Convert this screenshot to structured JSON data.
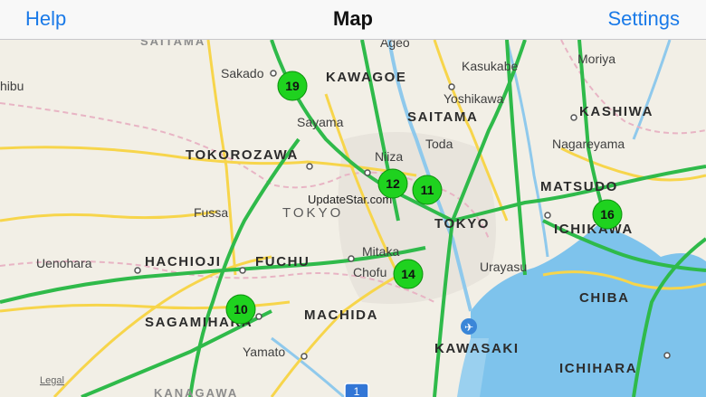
{
  "navbar": {
    "left": "Help",
    "title": "Map",
    "right": "Settings"
  },
  "map": {
    "places": {
      "saitama_pref": "SAITAMA",
      "kanagawa_pref": "KANAGAWA",
      "tokyo_pref": "TOKYO",
      "kawagoe": "KAWAGOE",
      "saitama": "SAITAMA",
      "kashiwa": "KASHIWA",
      "tokorozawa": "TOKOROZAWA",
      "matsudo": "MATSUDO",
      "tokyo": "TOKYO",
      "ichikawa": "ICHIKAWA",
      "hachioji": "HACHIOJI",
      "fuchu": "FUCHU",
      "chiba": "CHIBA",
      "sagamihara": "SAGAMIHARA",
      "machida": "MACHIDA",
      "kawasaki": "KAWASAKI",
      "ichihara": "ICHIHARA",
      "sakado": "Sakado",
      "ageo": "Ageo",
      "kasukabe": "Kasukabe",
      "moriya": "Moriya",
      "yoshikawa": "Yoshikawa",
      "sayama": "Sayama",
      "toda": "Toda",
      "nagareyama": "Nagareyama",
      "niiza": "Niiza",
      "fussa": "Fussa",
      "mitaka": "Mitaka",
      "chofu": "Chofu",
      "urayasu": "Urayasu",
      "uenohara": "Uenohara",
      "yamato": "Yamato",
      "hibu": "hibu"
    },
    "watermark": "UpdateStar.com",
    "legal": "Legal",
    "route_shield": "1",
    "pins": [
      "19",
      "12",
      "11",
      "16",
      "14",
      "10"
    ],
    "colors": {
      "land": "#f2efe6",
      "water": "#7ec3ec",
      "green_road": "#2fba4a",
      "yellow_road": "#f7d54b",
      "pin": "#1fd21f"
    }
  }
}
